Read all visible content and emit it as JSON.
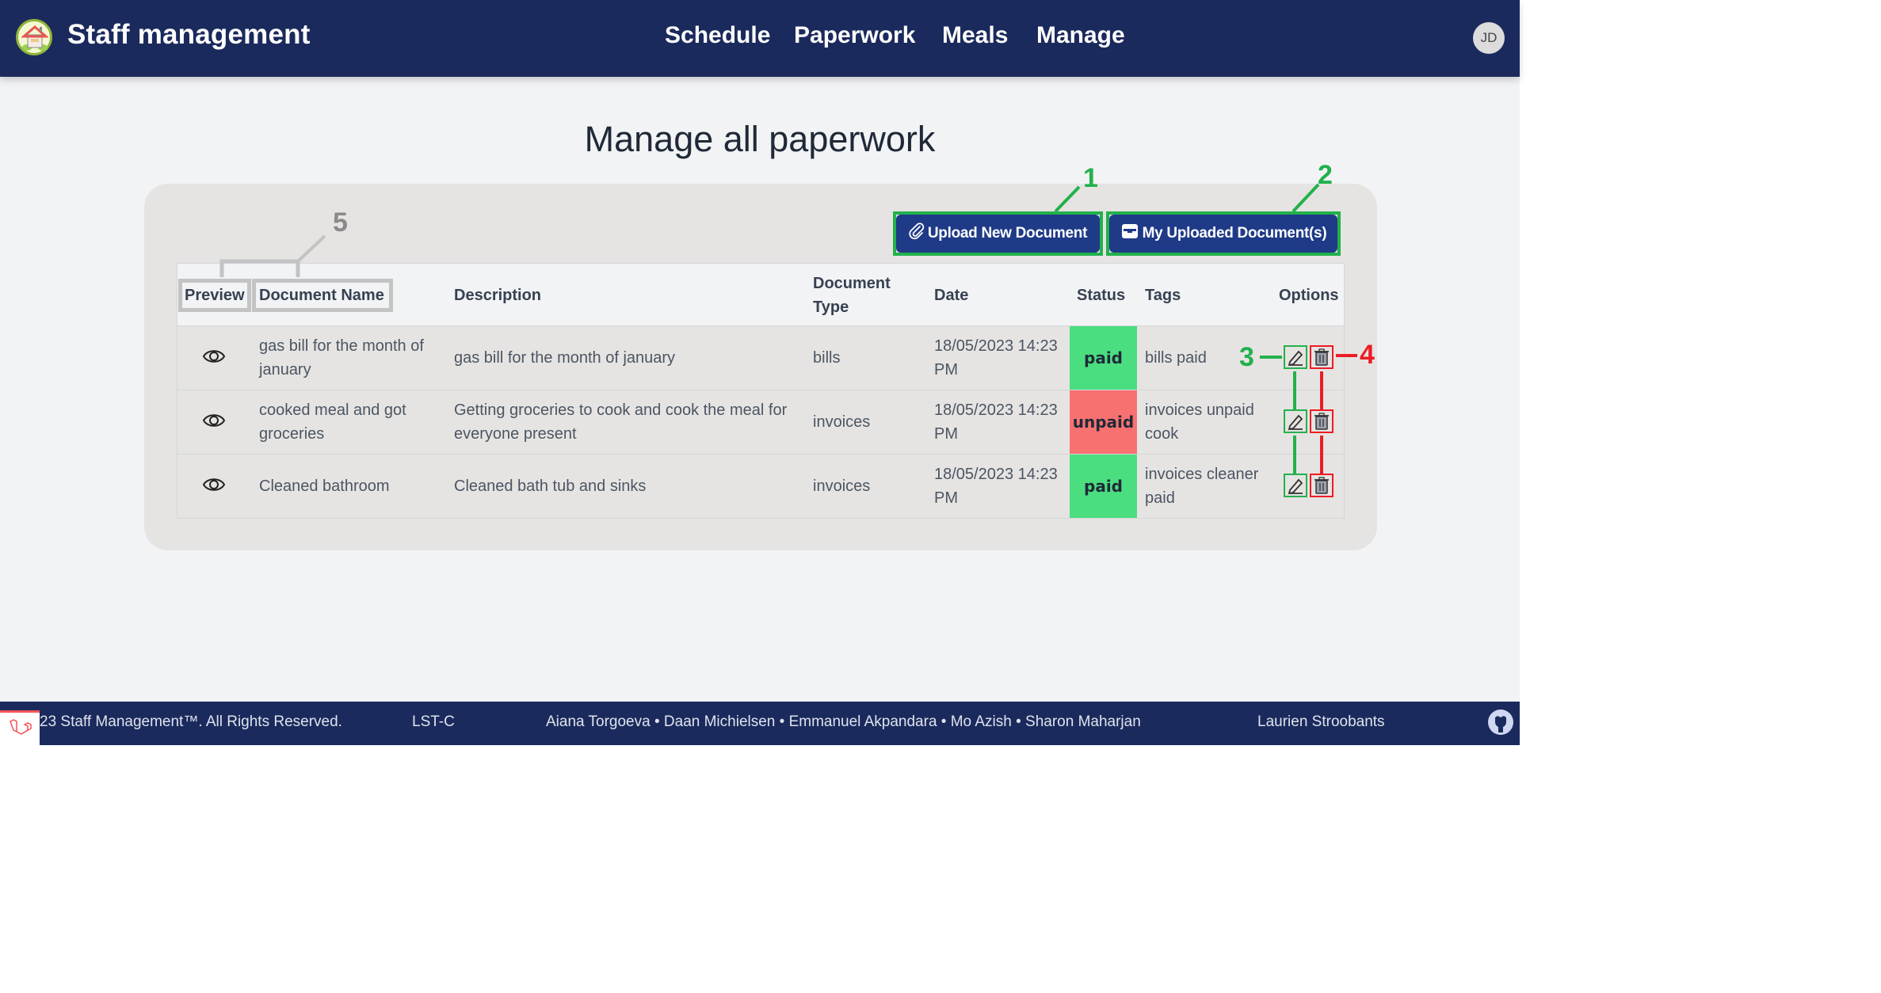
{
  "navbar": {
    "brand": "Staff management",
    "links": [
      "Schedule",
      "Paperwork",
      "Meals",
      "Manage"
    ],
    "avatar_initials": "JD",
    "bg_color": "#1b2a5c"
  },
  "main": {
    "title": "Manage all paperwork",
    "buttons": {
      "upload_label": "Upload New Document",
      "upload_icon": "paperclip-icon",
      "my_docs_label": "My Uploaded Document(s)",
      "my_docs_icon": "inbox-icon"
    },
    "table": {
      "headers": [
        "Preview",
        "Document Name",
        "Description",
        "Document Type",
        "Date",
        "Status",
        "Tags",
        "Options"
      ],
      "header_doc_type_lines": [
        "Document",
        "Type"
      ],
      "rows": [
        {
          "name_lines": [
            "gas bill for the month of",
            "january"
          ],
          "description_lines": [
            "gas bill for the month of january"
          ],
          "type": "bills",
          "date_lines": [
            "18/05/2023 14:23",
            "PM"
          ],
          "status": "paid",
          "tags_lines": [
            "bills paid"
          ]
        },
        {
          "name_lines": [
            "cooked meal and got",
            "groceries"
          ],
          "description_lines": [
            "Getting groceries to cook and cook the meal for",
            "everyone present"
          ],
          "type": "invoices",
          "date_lines": [
            "18/05/2023 14:23",
            "PM"
          ],
          "status": "unpaid",
          "tags_lines": [
            "invoices unpaid",
            "cook"
          ]
        },
        {
          "name_lines": [
            "Cleaned bathroom"
          ],
          "description_lines": [
            "Cleaned bath tub and sinks"
          ],
          "type": "invoices",
          "date_lines": [
            "18/05/2023 14:23",
            "PM"
          ],
          "status": "paid",
          "tags_lines": [
            "invoices cleaner",
            "paid"
          ]
        }
      ],
      "status_colors": {
        "paid": "#4ade80",
        "unpaid": "#f87171"
      }
    }
  },
  "annotations": {
    "labels": [
      "1",
      "2",
      "3",
      "4",
      "5"
    ],
    "colors": {
      "green": "#22b14c",
      "red": "#ed1c24",
      "gray": "#c3c3c3",
      "gray_text": "#8a8a8a"
    }
  },
  "footer": {
    "copyright": "23 Staff Management™. All Rights Reserved.",
    "class_code": "LST-C",
    "authors": "Aiana Torgoeva • Daan Michielsen • Emmanuel Akpandara • Mo Azish • Sharon Maharjan",
    "teacher": "Laurien Stroobants"
  }
}
